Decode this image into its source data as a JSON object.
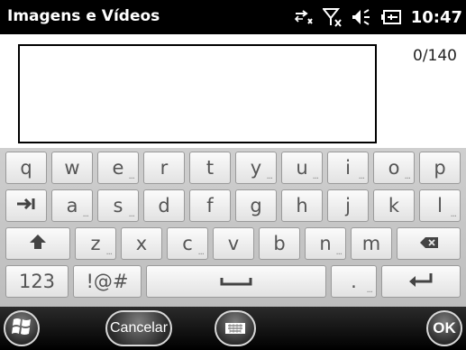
{
  "statusbar": {
    "title": "Imagens e Vídeos",
    "time": "10:47",
    "icons": [
      "data-connection-icon",
      "no-signal-icon",
      "volume-icon",
      "battery-icon"
    ]
  },
  "input": {
    "value": "",
    "counter": "0/140"
  },
  "keyboard": {
    "rows": [
      [
        {
          "label": "q"
        },
        {
          "label": "w"
        },
        {
          "label": "e",
          "more": true
        },
        {
          "label": "r"
        },
        {
          "label": "t"
        },
        {
          "label": "y",
          "more": true
        },
        {
          "label": "u",
          "more": true
        },
        {
          "label": "i",
          "more": true
        },
        {
          "label": "o",
          "more": true
        },
        {
          "label": "p"
        }
      ],
      [
        {
          "label": "tab",
          "icon": true
        },
        {
          "label": "a",
          "more": true
        },
        {
          "label": "s",
          "more": true
        },
        {
          "label": "d"
        },
        {
          "label": "f"
        },
        {
          "label": "g"
        },
        {
          "label": "h"
        },
        {
          "label": "j"
        },
        {
          "label": "k"
        },
        {
          "label": "l",
          "more": true
        }
      ],
      [
        {
          "label": "shift",
          "icon": true
        },
        {
          "label": "z",
          "more": true
        },
        {
          "label": "x"
        },
        {
          "label": "c",
          "more": true
        },
        {
          "label": "v"
        },
        {
          "label": "b"
        },
        {
          "label": "n",
          "more": true
        },
        {
          "label": "m"
        },
        {
          "label": "backspace",
          "icon": true
        }
      ],
      [
        {
          "label": "123"
        },
        {
          "label": "!@#"
        },
        {
          "label": "space",
          "icon": true
        },
        {
          "label": ".",
          "more": true
        },
        {
          "label": "enter",
          "icon": true
        }
      ]
    ]
  },
  "bottombar": {
    "start_icon": "windows-start-icon",
    "cancel_label": "Cancelar",
    "keyboard_icon": "keyboard-icon",
    "ok_label": "OK"
  },
  "colors": {
    "statusbar_bg": "#000000",
    "keyboard_bg": "#c6c6c6",
    "key_text": "#555555"
  }
}
